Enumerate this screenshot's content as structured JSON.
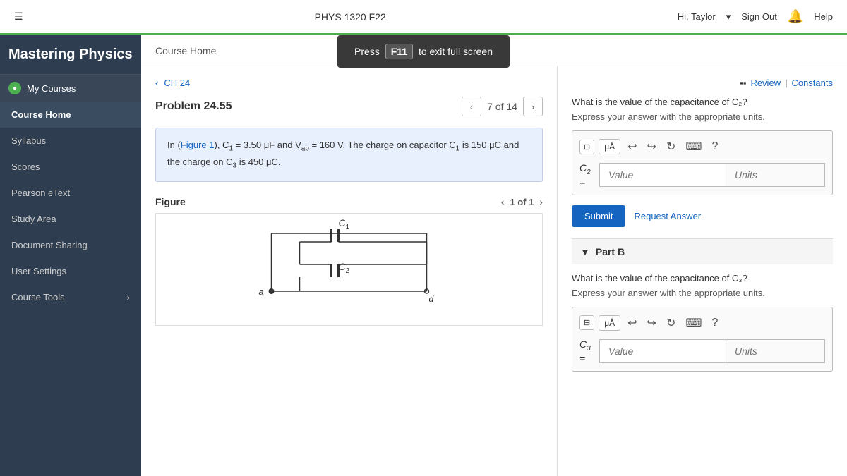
{
  "topbar": {
    "hamburger": "☰",
    "title": "PHYS 1320 F22",
    "user_greeting": "Hi, Taylor",
    "sign_out": "Sign Out",
    "help": "Help"
  },
  "fullscreen_tip": {
    "press": "Press",
    "key": "F11",
    "message": "to exit full screen"
  },
  "sidebar": {
    "brand": "Mastering Physics",
    "my_courses": "My Courses",
    "nav_items": [
      {
        "label": "Course Home",
        "active": true
      },
      {
        "label": "Syllabus",
        "active": false
      },
      {
        "label": "Scores",
        "active": false
      },
      {
        "label": "Pearson eText",
        "active": false
      },
      {
        "label": "Study Area",
        "active": false
      },
      {
        "label": "Document Sharing",
        "active": false
      },
      {
        "label": "User Settings",
        "active": false
      },
      {
        "label": "Course Tools",
        "active": false,
        "has_arrow": true
      }
    ]
  },
  "breadcrumb": {
    "label": "Course Home"
  },
  "problem": {
    "back_link": "‹CH 24",
    "title": "Problem 24.55",
    "page_current": "7",
    "page_total": "14",
    "page_label": "7 of 14",
    "description": "In (Figure 1), C₁ = 3.50 μF and V_ab = 160 V. The charge on capacitor C₁ is 150 μC and the charge on C₃ is 450 μC.",
    "figure_label": "Figure",
    "figure_nav": "1 of 1"
  },
  "part_a": {
    "question": "What is the value of the capacitance of C₂?",
    "subtext": "Express your answer with the appropriate units.",
    "label": "C₂ =",
    "value_placeholder": "Value",
    "units_placeholder": "Units",
    "submit": "Submit",
    "request_answer": "Request Answer"
  },
  "part_b": {
    "label": "Part B",
    "question": "What is the value of the capacitance of C₃?",
    "subtext": "Express your answer with the appropriate units.",
    "label_eq": "C₃ =",
    "value_placeholder": "Value",
    "units_placeholder": "Units"
  },
  "review_bar": {
    "icon": "▪▪",
    "review": "Review",
    "sep": "|",
    "constants": "Constants"
  }
}
